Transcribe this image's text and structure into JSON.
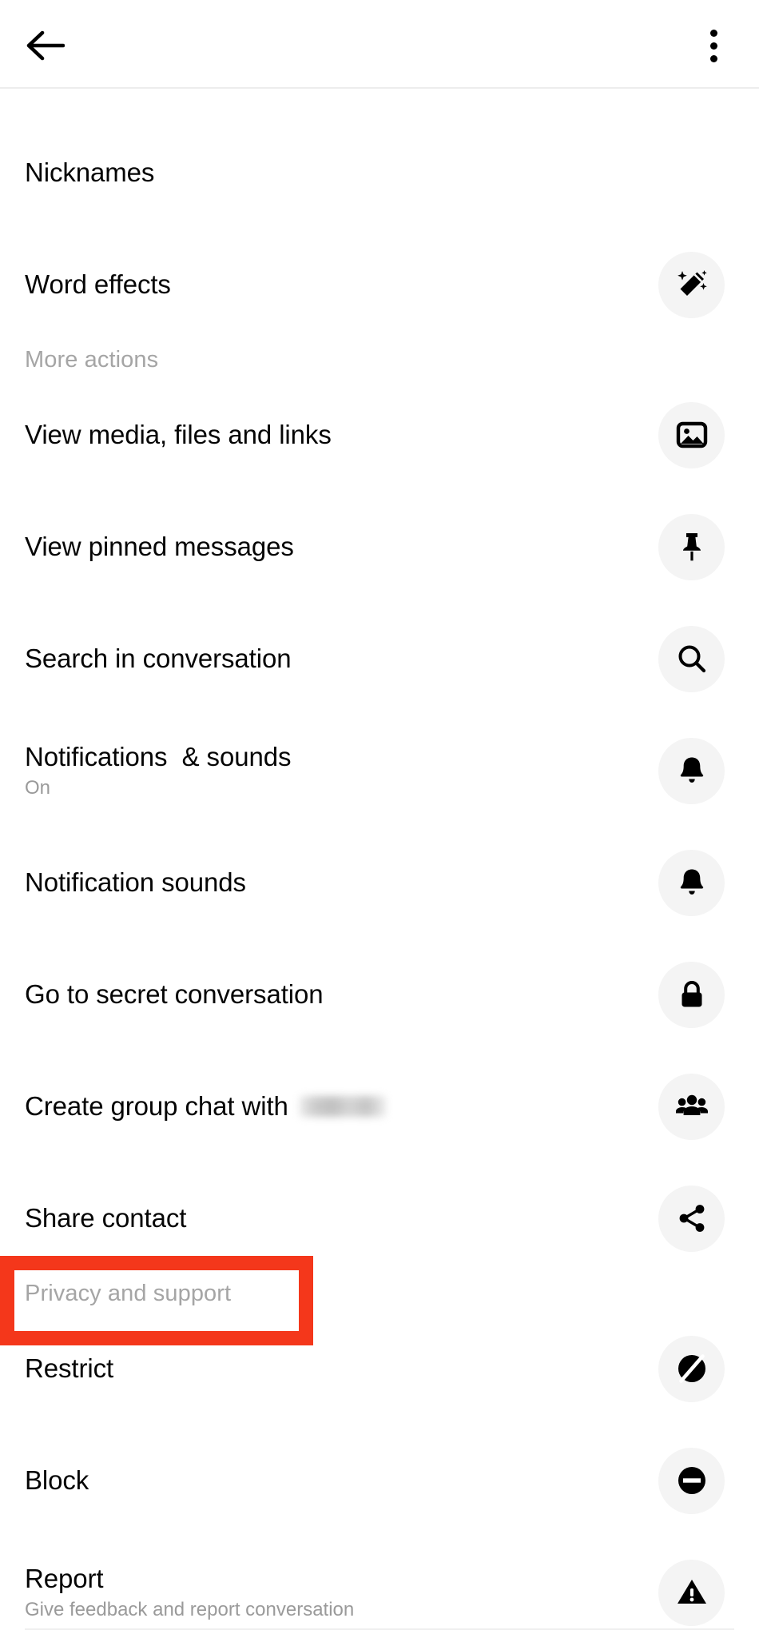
{
  "appbar": {
    "back_icon": "back-arrow-icon",
    "overflow_icon": "more-vertical-icon"
  },
  "sections": [
    {
      "id": "top",
      "header": null,
      "items": [
        {
          "title": "Nicknames",
          "subtitle": null,
          "icon": null
        },
        {
          "title": "Word effects",
          "subtitle": null,
          "icon": "magic-wand-icon"
        }
      ]
    },
    {
      "id": "more-actions",
      "header": "More actions",
      "items": [
        {
          "title": "View media, files and links",
          "subtitle": null,
          "icon": "image-icon"
        },
        {
          "title": "View pinned messages",
          "subtitle": null,
          "icon": "pin-icon"
        },
        {
          "title": "Search in conversation",
          "subtitle": null,
          "icon": "search-icon"
        },
        {
          "title": "Notifications  & sounds",
          "subtitle": "On",
          "icon": "bell-icon"
        },
        {
          "title": "Notification sounds",
          "subtitle": null,
          "icon": "bell-icon"
        },
        {
          "title": "Go to secret conversation",
          "subtitle": null,
          "icon": "lock-icon"
        },
        {
          "title": "Create group chat with",
          "subtitle": null,
          "icon": "people-group-icon",
          "redacted_name": true
        },
        {
          "title": "Share contact",
          "subtitle": null,
          "icon": "share-icon"
        }
      ]
    },
    {
      "id": "privacy-and-support",
      "header": "Privacy and support",
      "highlighted": true,
      "items": [
        {
          "title": "Restrict",
          "subtitle": null,
          "icon": "restrict-icon"
        },
        {
          "title": "Block",
          "subtitle": null,
          "icon": "block-icon"
        },
        {
          "title": "Report",
          "subtitle": "Give feedback and report conversation",
          "icon": "warning-icon"
        }
      ]
    }
  ],
  "colors": {
    "highlight": "#f4371b",
    "icon_circle_bg": "#f4f4f4",
    "primary_text": "#050505",
    "secondary_text": "#9a9a9a",
    "section_header_text": "#a5a5a5"
  }
}
